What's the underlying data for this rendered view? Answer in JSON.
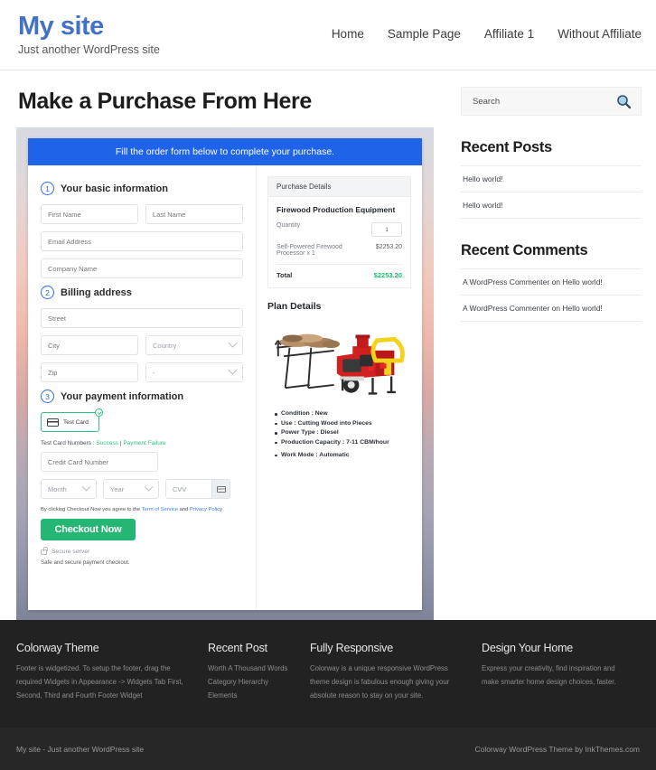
{
  "header": {
    "site_title": "My site",
    "tagline": "Just another WordPress site",
    "nav": [
      {
        "label": "Home"
      },
      {
        "label": "Sample Page"
      },
      {
        "label": "Affiliate 1"
      },
      {
        "label": "Without Affiliate"
      }
    ]
  },
  "main": {
    "page_title": "Make a Purchase From Here",
    "order_banner": "Fill the order form below to complete your purchase.",
    "steps": [
      {
        "num": "1",
        "label": "Your basic information"
      },
      {
        "num": "2",
        "label": "Billing address"
      },
      {
        "num": "3",
        "label": "Your payment information"
      }
    ],
    "fields": {
      "first_name": "First Name",
      "last_name": "Last Name",
      "email": "Email Address",
      "company": "Company Name",
      "street": "Street",
      "city": "City",
      "country": "Country",
      "zip": "Zip",
      "state": "-",
      "credit_card": "Credit Card Number",
      "month": "Month",
      "year": "Year",
      "cvv": "CVV"
    },
    "payment": {
      "card_option_label": "Test Card",
      "test_numbers_prefix": "Test Card Numbers : ",
      "test_success": "Success",
      "test_divider": " | ",
      "test_failure": "Payment Failure",
      "terms_prefix": "By clicking Checkout Now you agree to the ",
      "terms_link": "Term of Service",
      "terms_and": " and ",
      "privacy_link": "Privacy Policy",
      "checkout_button": "Checkout Now",
      "secure_server": "Secure server",
      "safe_note": "Safe and secure payment checkout."
    },
    "purchase_details": {
      "heading": "Purchase Details",
      "product_name": "Firewood Production Equipment",
      "quantity_label": "Quantity",
      "quantity_value": "1",
      "line_item_label": "Self-Powered Firewood Processor x 1",
      "line_item_amount": "$2253.20",
      "total_label": "Total",
      "total_amount": "$2253.20"
    },
    "plan_details": {
      "heading": "Plan Details",
      "specs": [
        "Condition : New",
        "Use : Cutting Wood into Pieces",
        "Power Type : Diesel",
        "Production Capacity : 7-11 CBM/hour",
        "Work Mode : Automatic"
      ]
    }
  },
  "sidebar": {
    "search_placeholder": "Search",
    "recent_posts_title": "Recent Posts",
    "recent_posts": [
      {
        "label": "Hello world!"
      },
      {
        "label": "Hello world!"
      }
    ],
    "recent_comments_title": "Recent Comments",
    "recent_comments": [
      {
        "label": "A WordPress Commenter on Hello world!"
      },
      {
        "label": "A WordPress Commenter on Hello world!"
      }
    ]
  },
  "footer": {
    "columns": [
      {
        "title": "Colorway Theme",
        "text": "Footer is widgetized. To setup the footer, drag the required Widgets in Appearance -> Widgets Tab First, Second, Third and Fourth Footer Widget"
      },
      {
        "title": "Recent Post",
        "items": [
          {
            "label": "Worth A Thousand Words"
          },
          {
            "label": "Category Hierarchy"
          },
          {
            "label": "Elements"
          }
        ]
      },
      {
        "title": "Fully Responsive",
        "text": "Colorway is a unique responsive WordPress theme design is fabulous enough giving your absolute reason to stay on your site."
      },
      {
        "title": "Design Your Home",
        "text": "Express your creativity, find inspiration and make smarter home design choices, faster."
      }
    ],
    "copyright_left": "My site - Just another WordPress site",
    "copyright_right": "Colorway WordPress Theme by InkThemes.com"
  },
  "colors": {
    "brand_blue": "#4372c4",
    "banner_blue": "#1f63e8",
    "accent_green": "#26b673",
    "total_green": "#18bd6b",
    "footer_bg": "#222222"
  }
}
